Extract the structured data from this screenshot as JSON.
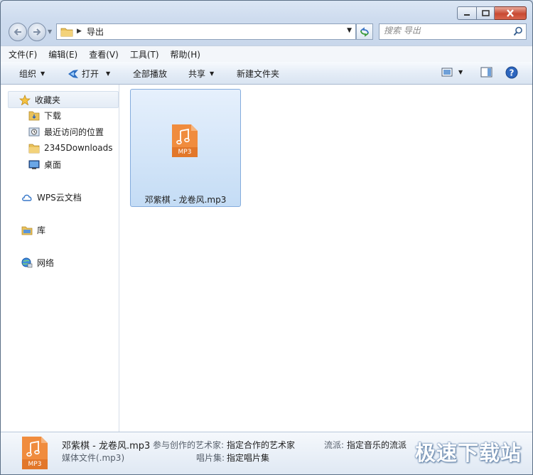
{
  "window": {
    "caption": {
      "minimize_icon": "minimize-icon",
      "maximize_icon": "maximize-icon",
      "close_icon": "close-icon"
    }
  },
  "address": {
    "path": "导出"
  },
  "search": {
    "placeholder": "搜索 导出"
  },
  "menu": [
    "文件(F)",
    "编辑(E)",
    "查看(V)",
    "工具(T)",
    "帮助(H)"
  ],
  "toolbar": {
    "organize": "组织",
    "open": "打开",
    "play_all": "全部播放",
    "share": "共享",
    "new_folder": "新建文件夹"
  },
  "nav": {
    "favorites": "收藏夹",
    "downloads": "下载",
    "recent": "最近访问的位置",
    "downloads2345": "2345Downloads",
    "desktop": "桌面",
    "wps": "WPS云文档",
    "library": "库",
    "network": "网络"
  },
  "file": {
    "name": "邓紫棋 - 龙卷风.mp3",
    "badge": "MP3"
  },
  "details": {
    "title": "邓紫棋 - 龙卷风.mp3",
    "type": "媒体文件(.mp3)",
    "artist_label": "参与创作的艺术家:",
    "artist_value": "指定合作的艺术家",
    "album_label": "唱片集:",
    "album_value": "指定唱片集",
    "genre_label": "流派:",
    "genre_value": "指定音乐的流派",
    "badge": "MP3"
  },
  "watermark": "极速下载站",
  "colors": {
    "mp3_orange": "#f08c3e",
    "selection": "#c4dcf5",
    "accent": "#1e5fb4"
  }
}
